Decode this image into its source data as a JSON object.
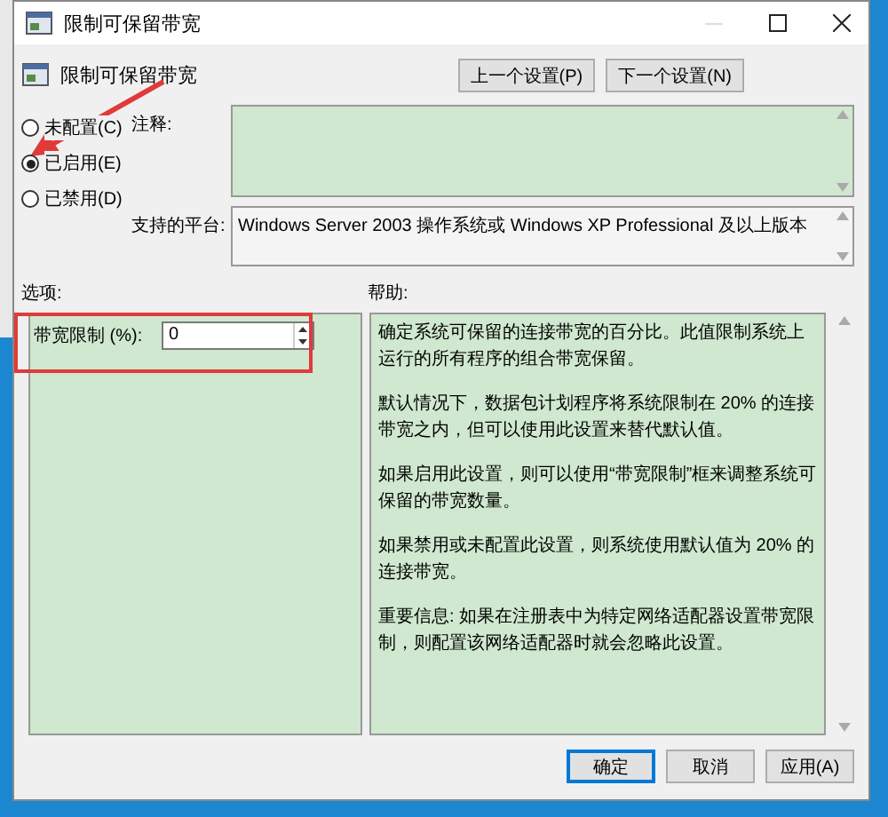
{
  "window": {
    "title": "限制可保留带宽"
  },
  "policy": {
    "name": "限制可保留带宽"
  },
  "nav_buttons": [
    "上一个设置(P)",
    "下一个设置(N)"
  ],
  "states": [
    {
      "label": "未配置(C)",
      "selected": false
    },
    {
      "label": "已启用(E)",
      "selected": true
    },
    {
      "label": "已禁用(D)",
      "selected": false
    }
  ],
  "comment": {
    "label": "注释:"
  },
  "platform": {
    "label": "支持的平台:",
    "value": "Windows Server 2003 操作系统或 Windows XP Professional 及以上版本"
  },
  "options": {
    "heading": "选项:",
    "fields": [
      {
        "label": "带宽限制 (%):",
        "value": "0"
      }
    ]
  },
  "help": {
    "heading": "帮助:",
    "paragraphs": [
      "确定系统可保留的连接带宽的百分比。此值限制系统上运行的所有程序的组合带宽保留。",
      "默认情况下，数据包计划程序将系统限制在 20% 的连接带宽之内，但可以使用此设置来替代默认值。",
      "如果启用此设置，则可以使用“带宽限制”框来调整系统可保留的带宽数量。",
      "如果禁用或未配置此设置，则系统使用默认值为 20% 的连接带宽。",
      "重要信息: 如果在注册表中为特定网络适配器设置带宽限制，则配置该网络适配器时就会忽略此设置。"
    ]
  },
  "buttons": [
    {
      "label": "确定",
      "default": true
    },
    {
      "label": "取消",
      "default": false
    },
    {
      "label": "应用(A)",
      "default": false
    }
  ]
}
